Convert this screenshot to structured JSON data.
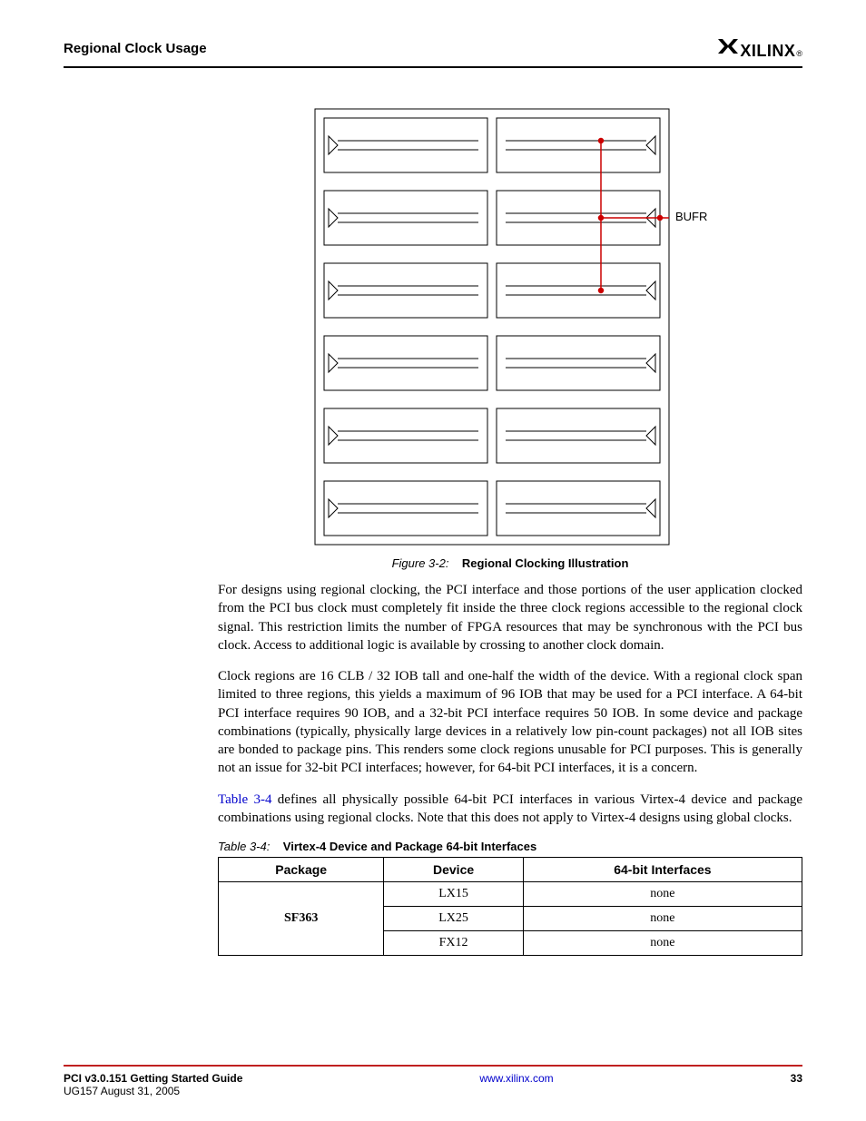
{
  "header": {
    "section": "Regional Clock Usage",
    "brand": "XILINX",
    "reg": "®"
  },
  "figure": {
    "label": "Figure 3-2:",
    "title": "Regional Clocking Illustration",
    "bufr_label": "BUFR"
  },
  "paragraphs": {
    "p1": "For designs using regional clocking, the PCI interface and those portions of the user application clocked from the PCI bus clock must completely fit inside the three clock regions accessible to the regional clock signal. This restriction limits the number of FPGA resources that may be synchronous with the PCI bus clock. Access to additional logic is available by crossing to another clock domain.",
    "p2": "Clock regions are 16 CLB / 32 IOB tall and one-half the width of the device. With a regional clock span limited to three regions, this yields a maximum of 96 IOB that may be used for a PCI interface. A 64-bit PCI interface requires 90 IOB, and a 32-bit PCI interface requires 50 IOB. In some device and package combinations (typically, physically large devices in a relatively low pin-count packages) not all IOB sites are bonded to package pins. This renders some clock regions unusable for PCI purposes. This is generally not an issue for 32-bit PCI interfaces; however, for 64-bit PCI interfaces, it is a concern.",
    "p3_link": "Table 3-4",
    "p3_rest": " defines all physically possible 64-bit PCI interfaces in various Virtex-4 device and package combinations using regional clocks. Note that this does not apply to Virtex-4 designs using global clocks."
  },
  "table": {
    "label": "Table 3-4:",
    "title": "Virtex-4 Device and Package 64-bit Interfaces",
    "headers": {
      "c1": "Package",
      "c2": "Device",
      "c3": "64-bit Interfaces"
    },
    "rows": [
      {
        "package": "SF363",
        "device": "LX15",
        "interfaces": "none"
      },
      {
        "package": "",
        "device": "LX25",
        "interfaces": "none"
      },
      {
        "package": "",
        "device": "FX12",
        "interfaces": "none"
      }
    ]
  },
  "footer": {
    "title": "PCI v3.0.151 Getting Started Guide",
    "sub": "UG157 August 31, 2005",
    "url": "www.xilinx.com",
    "page": "33"
  }
}
